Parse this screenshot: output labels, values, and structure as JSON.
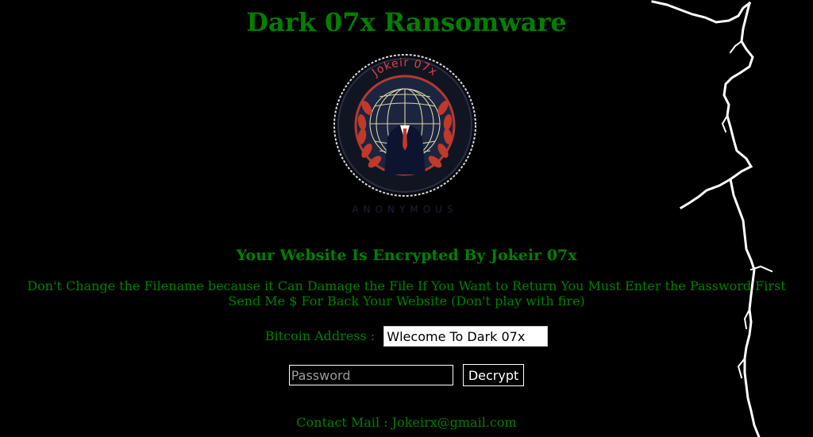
{
  "page": {
    "title": "Dark 07x Ransomware",
    "subtitle": "Your Website Is Encrypted By Jokeir 07x",
    "message_line1": "Don't Change the Filename because it Can Damage the File If You Want to Return You Must Enter the Password First",
    "message_line2": "Send Me $ For Back Your Website (Don't play with fire)",
    "contact": "Contact Mail : Jokeirx@gmail.com"
  },
  "logo": {
    "text": "Jokeir 07x",
    "bottom_text": "ANONYMOUS",
    "icon": "anonymous-emblem"
  },
  "bitcoin": {
    "label": "Bitcoin Address :",
    "value": "Wlecome To Dark 07x"
  },
  "password": {
    "placeholder": "Password",
    "value": ""
  },
  "decrypt": {
    "label": "Decrypt"
  },
  "colors": {
    "background": "#000000",
    "text": "#008000",
    "lightning": "#ffffff",
    "emblem_red": "#c0392b",
    "emblem_navy": "#1b2540"
  }
}
